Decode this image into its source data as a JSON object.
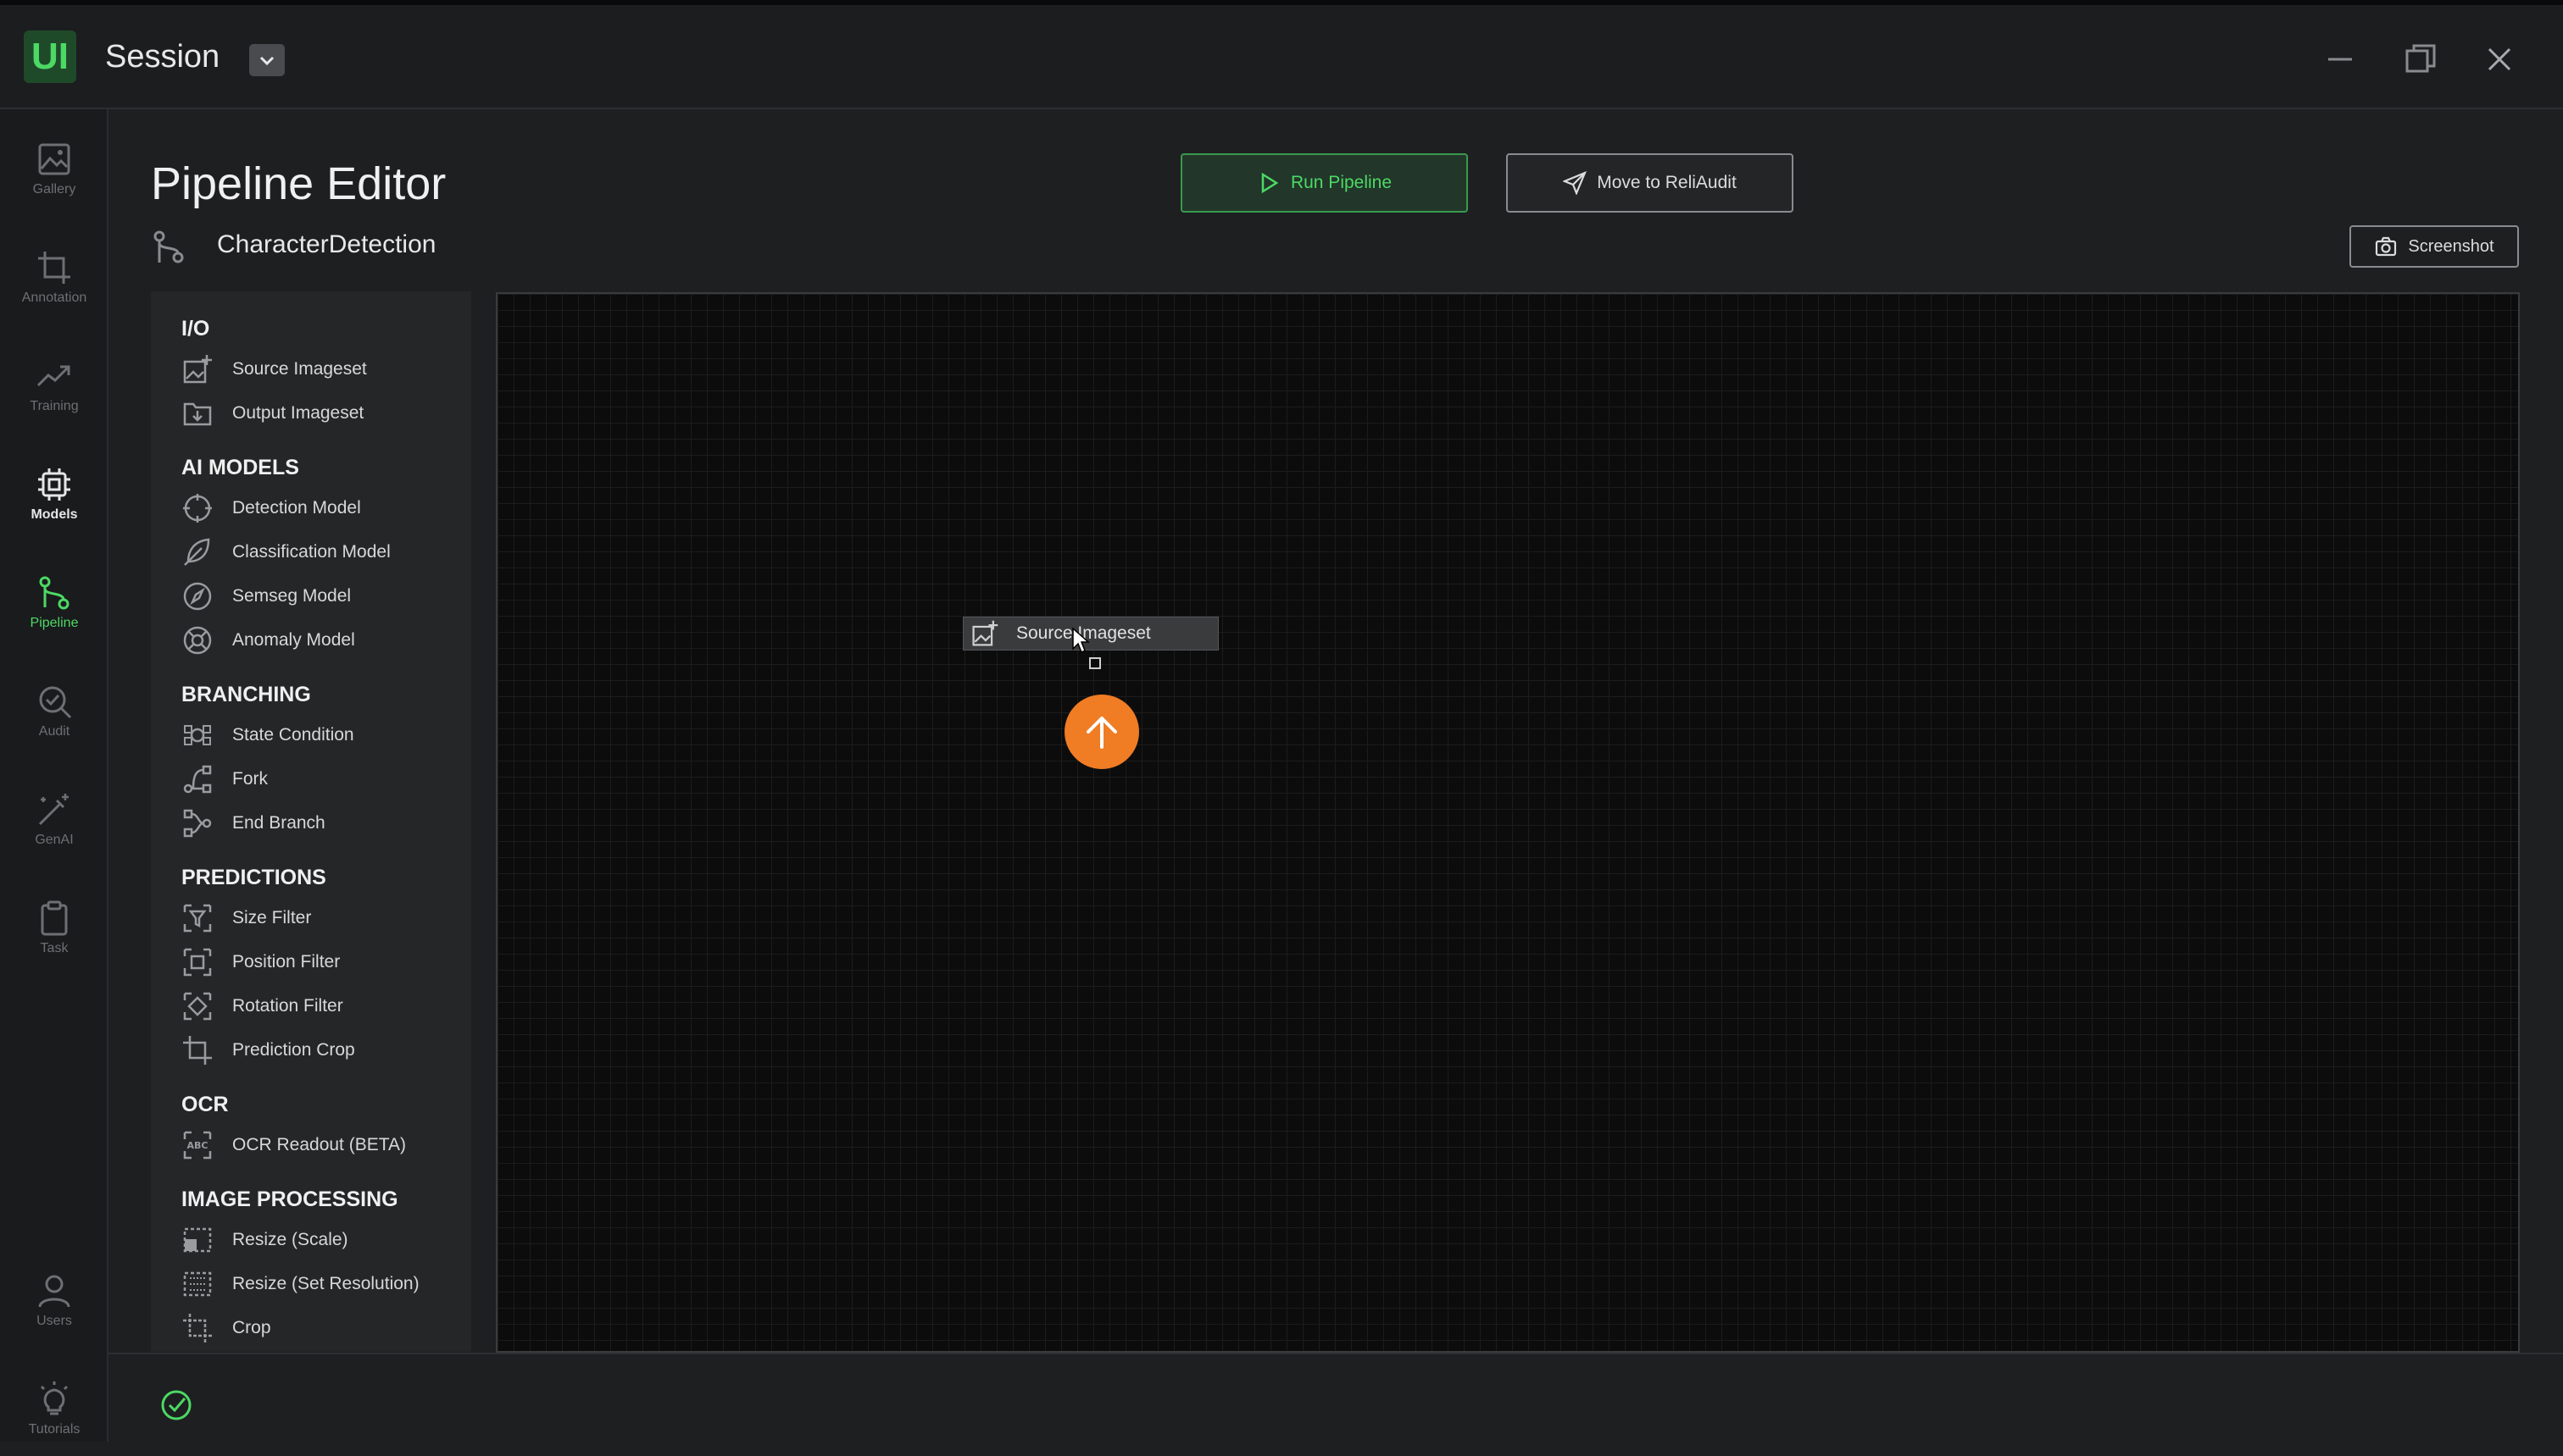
{
  "app": {
    "logo_text": "UI",
    "session_title": "Session"
  },
  "nav": [
    {
      "label": "Gallery",
      "icon": "image-icon"
    },
    {
      "label": "Annotation",
      "icon": "crop-icon"
    },
    {
      "label": "Training",
      "icon": "trend-icon"
    },
    {
      "label": "Models",
      "icon": "chip-icon"
    },
    {
      "label": "Pipeline",
      "icon": "pipeline-icon"
    },
    {
      "label": "Audit",
      "icon": "audit-icon"
    },
    {
      "label": "GenAI",
      "icon": "wand-icon"
    },
    {
      "label": "Task",
      "icon": "clipboard-icon"
    },
    {
      "label": "Users",
      "icon": "user-icon"
    },
    {
      "label": "Tutorials",
      "icon": "lightbulb-icon"
    }
  ],
  "header": {
    "title": "Pipeline Editor",
    "pipeline_name": "CharacterDetection",
    "run_label": "Run Pipeline",
    "move_label": "Move to ReliAudit",
    "screenshot_label": "Screenshot"
  },
  "palette": {
    "io": {
      "title": "I/O",
      "items": [
        "Source Imageset",
        "Output Imageset"
      ]
    },
    "ai_models": {
      "title": "AI MODELS",
      "items": [
        "Detection Model",
        "Classification Model",
        "Semseg Model",
        "Anomaly Model"
      ]
    },
    "branching": {
      "title": "BRANCHING",
      "items": [
        "State Condition",
        "Fork",
        "End Branch"
      ]
    },
    "predictions": {
      "title": "PREDICTIONS",
      "items": [
        "Size Filter",
        "Position Filter",
        "Rotation Filter",
        "Prediction Crop"
      ]
    },
    "ocr": {
      "title": "OCR",
      "items": [
        "OCR Readout (BETA)"
      ]
    },
    "image_processing": {
      "title": "IMAGE PROCESSING",
      "items": [
        "Resize (Scale)",
        "Resize (Set Resolution)",
        "Crop"
      ]
    }
  },
  "canvas": {
    "node_label": "Source Imageset"
  },
  "colors": {
    "accent_green": "#4cd964",
    "upload_orange": "#f07c24"
  }
}
